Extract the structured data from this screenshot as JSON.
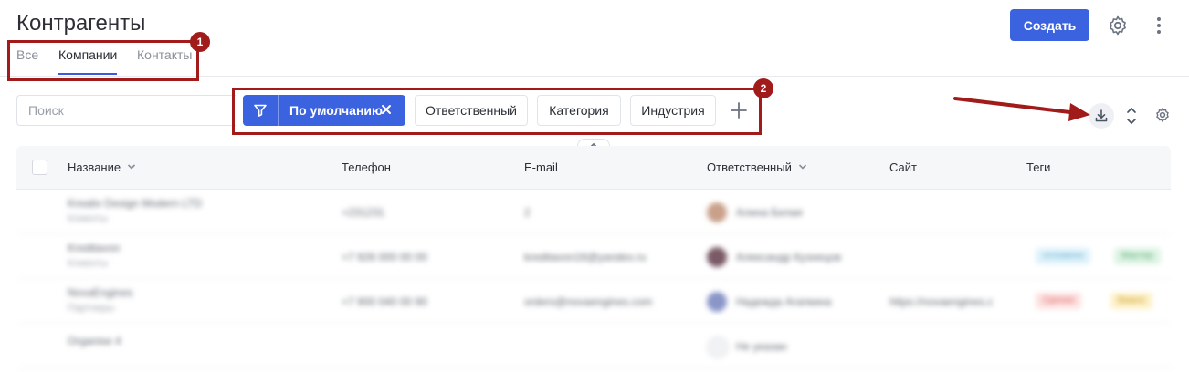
{
  "page": {
    "title": "Контрагенты"
  },
  "tabs": [
    {
      "label": "Все",
      "active": false
    },
    {
      "label": "Компании",
      "active": true
    },
    {
      "label": "Контакты",
      "active": false
    }
  ],
  "header": {
    "create_label": "Создать",
    "settings_icon": "gear-icon",
    "more_icon": "more-vertical-icon"
  },
  "search": {
    "placeholder": "Поиск",
    "value": ""
  },
  "filters": {
    "active_preset": "По умолчанию",
    "chips": [
      "Ответственный",
      "Категория",
      "Индустрия"
    ],
    "add_icon": "plus-icon"
  },
  "toolbar": {
    "download_icon": "download-icon",
    "collapse_icon": "chevrons-icon",
    "settings_icon": "gear-icon"
  },
  "annotations": {
    "badge1": "1",
    "badge2": "2"
  },
  "colors": {
    "accent": "#3b63e0",
    "annotation": "#a11b1b"
  },
  "table": {
    "columns": [
      "Название",
      "Телефон",
      "E-mail",
      "Ответственный",
      "Сайт",
      "Теги"
    ],
    "rows": [
      {
        "name": "Kreativ Design Modern LTD",
        "category": "Клиенты",
        "phone": "+231231",
        "email": "2",
        "responsible": "Алина Белая",
        "site": "",
        "tags": []
      },
      {
        "name": "Kreditavon",
        "category": "Клиенты",
        "phone": "+7 926 000 00 00",
        "email": "kreditavon16@yandex.ru",
        "responsible": "Александр Кузнецов",
        "site": "",
        "tags": [
          "отложено",
          "Мастер"
        ]
      },
      {
        "name": "NovaEngines",
        "category": "Партнеры",
        "phone": "+7 900 040 00 90",
        "email": "orders@novaengines.com",
        "responsible": "Надежда Агапкина",
        "site": "https://novaengines.c",
        "tags": [
          "Срочно",
          "Важно"
        ]
      },
      {
        "name": "Organise 4",
        "category": "",
        "phone": "",
        "email": "",
        "responsible": "Не указан",
        "site": "",
        "tags": []
      }
    ]
  }
}
